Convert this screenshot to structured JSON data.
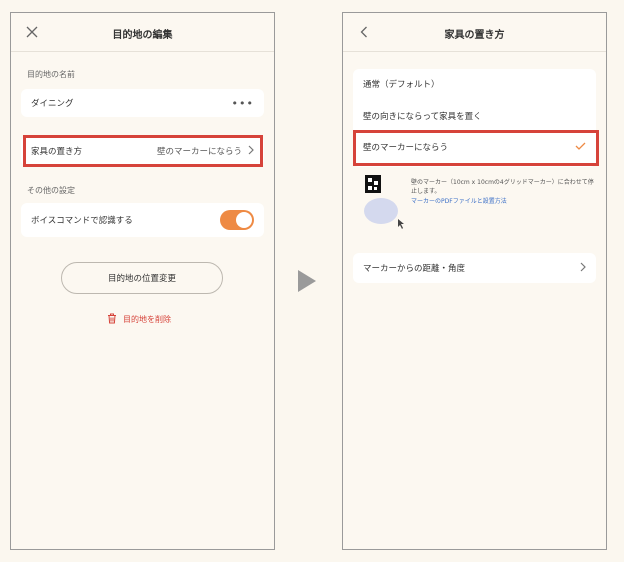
{
  "left": {
    "title": "目的地の編集",
    "section_name": "目的地の名前",
    "name_value": "ダイニング",
    "furniture_label": "家具の置き方",
    "furniture_value": "壁のマーカーにならう",
    "section_other": "その他の設定",
    "voice_label": "ボイスコマンドで認識する",
    "voice_on": true,
    "change_position": "目的地の位置変更",
    "delete": "目的地を削除"
  },
  "right": {
    "title": "家具の置き方",
    "options": [
      {
        "label": "通常（デフォルト）",
        "selected": false
      },
      {
        "label": "壁の向きにならって家具を置く",
        "selected": false
      },
      {
        "label": "壁のマーカーにならう",
        "selected": true
      }
    ],
    "marker_desc": "壁のマーカー（10cm x 10cmの4グリッドマーカー）に合わせて停止します。",
    "marker_link": "マーカーのPDFファイルと設置方法",
    "distance_angle": "マーカーからの距離・角度"
  },
  "colors": {
    "accent": "#ee8a44",
    "highlight": "#d6433a",
    "link": "#3b6fc7"
  }
}
